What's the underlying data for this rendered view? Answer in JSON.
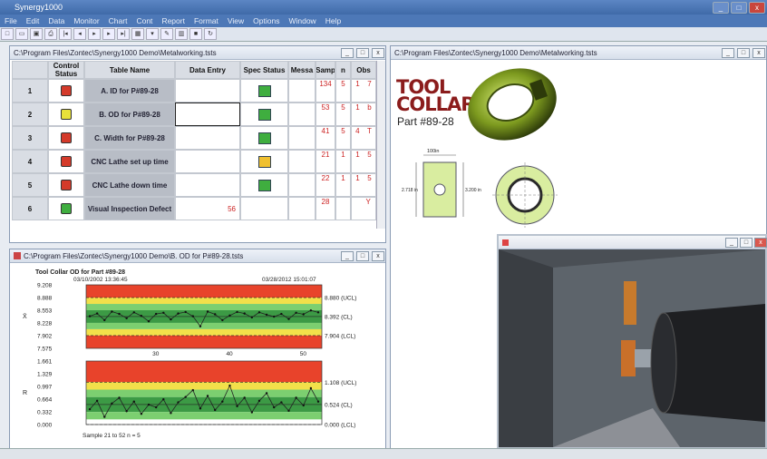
{
  "app": {
    "title": "Synergy1000"
  },
  "menu": [
    "File",
    "Edit",
    "Data",
    "Monitor",
    "Chart",
    "Cont",
    "Report",
    "Format",
    "View",
    "Options",
    "Window",
    "Help"
  ],
  "toolbar_icons": [
    "new-icon",
    "open-icon",
    "save-icon",
    "print-icon",
    "first-icon",
    "prev-icon",
    "play-icon",
    "next-icon",
    "last-icon",
    "grid-icon",
    "filter-icon",
    "edit-icon",
    "chart-icon",
    "stop-icon",
    "refresh-icon"
  ],
  "table_window": {
    "title": "C:\\Program Files\\Zontec\\Synergy1000 Demo\\Metalworking.tsts",
    "columns": [
      "Control Status",
      "Table Name",
      "Data Entry",
      "Spec Status",
      "Messa",
      "Samp",
      "n",
      "Obs"
    ],
    "rows": [
      {
        "num": "1",
        "control": "#d43a2a",
        "name": "A. ID for P#89-28",
        "entry": "",
        "spec": "#3fae3f",
        "msg": "",
        "samp": "134",
        "n": "5",
        "obs": "1",
        "obs2": "7"
      },
      {
        "num": "2",
        "control": "#e8e03a",
        "name": "B. OD for P#89-28",
        "entry": "",
        "spec": "#3fae3f",
        "msg": "",
        "samp": "53",
        "n": "5",
        "obs": "1",
        "obs2": "b"
      },
      {
        "num": "3",
        "control": "#d43a2a",
        "name": "C. Width for P#89-28",
        "entry": "",
        "spec": "#3fae3f",
        "msg": "",
        "samp": "41",
        "n": "5",
        "obs": "4",
        "obs2": "T"
      },
      {
        "num": "4",
        "control": "#d43a2a",
        "name": "CNC Lathe set up time",
        "entry": "",
        "spec": "#f0c030",
        "msg": "",
        "samp": "21",
        "n": "1",
        "obs": "1",
        "obs2": "5"
      },
      {
        "num": "5",
        "control": "#d43a2a",
        "name": "CNC Lathe down time",
        "entry": "",
        "spec": "#3fae3f",
        "msg": "",
        "samp": "22",
        "n": "1",
        "obs": "1",
        "obs2": "5"
      },
      {
        "num": "6",
        "control": "#3fae3f",
        "name": "Visual Inspection Defect",
        "entry": "56",
        "spec": "",
        "msg": "",
        "samp": "28",
        "n": "",
        "obs": "",
        "obs2": "Y"
      }
    ]
  },
  "chart_window": {
    "title": "C:\\Program Files\\Zontec\\Synergy1000 Demo\\B. OD for P#89-28.tsts",
    "chart_title": "Tool Collar OD for Part #89-28",
    "start_stamp": "03/10/2002 13:36:45",
    "end_stamp": "03/28/2012 15:01:07",
    "footer": "Sample 21 to 52 n = 5"
  },
  "chart_data": [
    {
      "type": "line",
      "title": "Tool Collar OD for Part #89-28",
      "ylabel": "X̄",
      "yticks": [
        "9.208",
        "8.888",
        "8.553",
        "8.228",
        "7.902",
        "7.575"
      ],
      "ylim": [
        7.575,
        9.208
      ],
      "xticks": [
        "30",
        "40",
        "50"
      ],
      "limits": [
        {
          "label": "8.880 (UCL)",
          "value": 8.88
        },
        {
          "label": "8.392 (CL)",
          "value": 8.392
        },
        {
          "label": "7.904 (LCL)",
          "value": 7.904
        }
      ],
      "x": [
        21,
        22,
        23,
        24,
        25,
        26,
        27,
        28,
        29,
        30,
        31,
        32,
        33,
        34,
        35,
        36,
        37,
        38,
        39,
        40,
        41,
        42,
        43,
        44,
        45,
        46,
        47,
        48,
        49,
        50,
        51,
        52
      ],
      "values": [
        8.4,
        8.47,
        8.3,
        8.52,
        8.46,
        8.35,
        8.5,
        8.41,
        8.27,
        8.46,
        8.49,
        8.32,
        8.47,
        8.51,
        8.4,
        8.14,
        8.52,
        8.45,
        8.3,
        8.42,
        8.51,
        8.47,
        8.37,
        8.5,
        8.44,
        8.39,
        8.46,
        8.33,
        8.49,
        8.45,
        8.55,
        8.5
      ]
    },
    {
      "type": "line",
      "ylabel": "R",
      "yticks": [
        "1.661",
        "1.329",
        "0.997",
        "0.664",
        "0.332",
        "0.000"
      ],
      "ylim": [
        0,
        1.661
      ],
      "limits": [
        {
          "label": "1.108 (UCL)",
          "value": 1.108
        },
        {
          "label": "0.524 (CL)",
          "value": 0.524
        },
        {
          "label": "0.000 (LCL)",
          "value": 0.0
        }
      ],
      "x": [
        21,
        22,
        23,
        24,
        25,
        26,
        27,
        28,
        29,
        30,
        31,
        32,
        33,
        34,
        35,
        36,
        37,
        38,
        39,
        40,
        41,
        42,
        43,
        44,
        45,
        46,
        47,
        48,
        49,
        50,
        51,
        52
      ],
      "values": [
        0.4,
        0.62,
        0.2,
        0.55,
        0.7,
        0.35,
        0.6,
        0.28,
        0.52,
        0.45,
        0.66,
        0.3,
        0.58,
        0.72,
        0.9,
        0.42,
        0.75,
        0.38,
        0.6,
        1.02,
        0.48,
        0.7,
        0.32,
        0.62,
        0.82,
        0.45,
        0.58,
        0.36,
        0.7,
        0.5,
        0.95,
        0.6
      ]
    }
  ],
  "drawing_window": {
    "title": "C:\\Program Files\\Zontec\\Synergy1000 Demo\\Metalworking.tsts",
    "heading1": "TOOL",
    "heading2": "COLLAR",
    "part": "Part #89-28",
    "dim_top": "100in",
    "dim_left": "2.718 in",
    "dim_right": "3.200 in"
  },
  "viewer_window": {
    "title": ""
  }
}
